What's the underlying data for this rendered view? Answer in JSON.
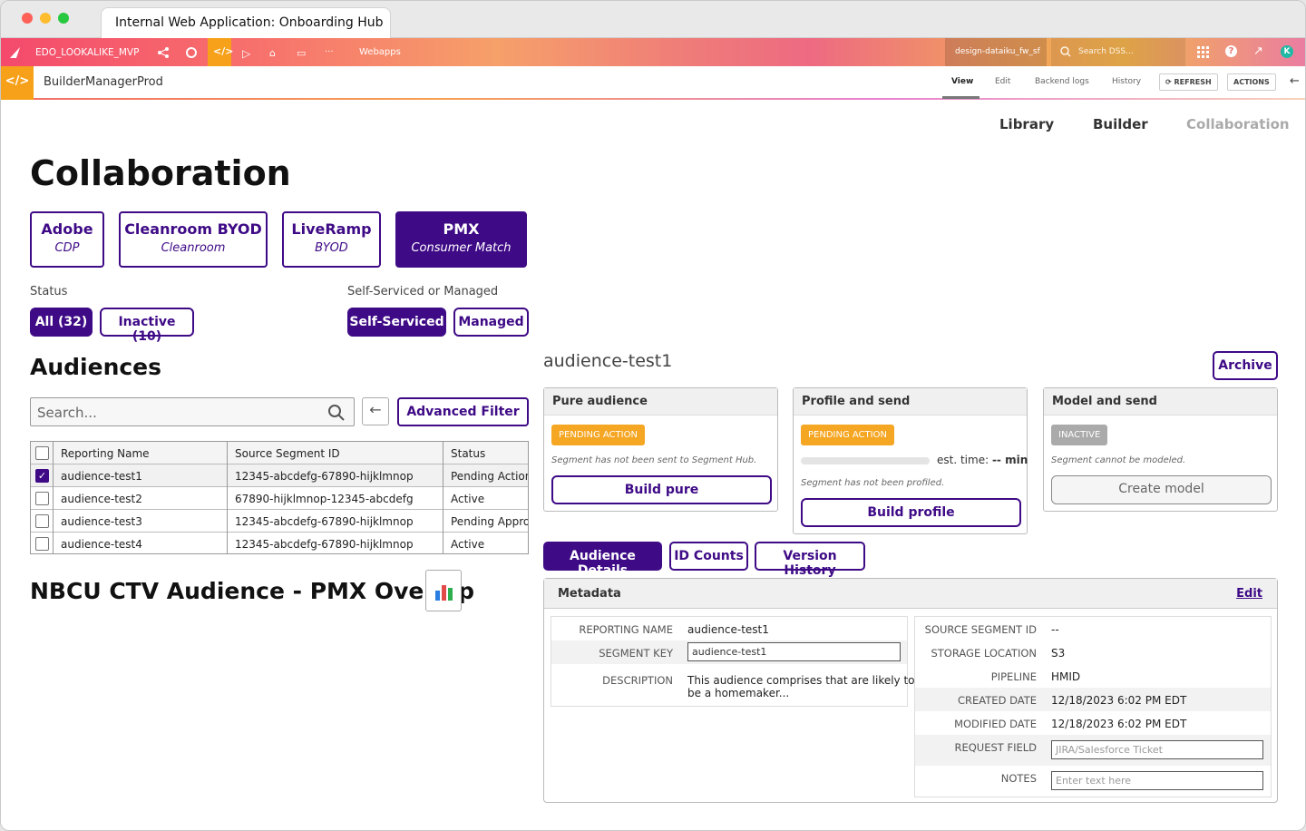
{
  "browser": {
    "tab_title": "Internal Web Application: Onboarding Hub"
  },
  "dss": {
    "project": "EDO_LOOKALIKE_MVP",
    "menu": "Webapps",
    "instance": "design-dataiku_fw_sf",
    "search_placeholder": "Search DSS...",
    "avatar": "K"
  },
  "webapp_bar": {
    "name": "BuilderManagerProd",
    "tabs": [
      "View",
      "Edit",
      "Backend logs",
      "History"
    ],
    "refresh": "REFRESH",
    "actions": "ACTIONS"
  },
  "topnav": [
    "Library",
    "Builder",
    "Collaboration"
  ],
  "page_title": "Collaboration",
  "partners": [
    {
      "name": "Adobe",
      "type": "CDP"
    },
    {
      "name": "Cleanroom BYOD",
      "type": "Cleanroom"
    },
    {
      "name": "LiveRamp",
      "type": "BYOD"
    },
    {
      "name": "PMX",
      "type": "Consumer Match"
    }
  ],
  "filters": {
    "status_label": "Status",
    "status_options": [
      "All (32)",
      "Inactive (10)"
    ],
    "service_label": "Self-Serviced or Managed",
    "service_options": [
      "Self-Serviced",
      "Managed"
    ]
  },
  "audiences": {
    "heading": "Audiences",
    "search_placeholder": "Search...",
    "advanced_filter": "Advanced Filter",
    "columns": [
      "Reporting Name",
      "Source Segment ID",
      "Status"
    ],
    "rows": [
      {
        "name": "audience-test1",
        "segment": "12345-abcdefg-67890-hijklmnop",
        "status": "Pending Action",
        "checked": true
      },
      {
        "name": "audience-test2",
        "segment": "67890-hijklmnop-12345-abcdefg",
        "status": "Active",
        "checked": false
      },
      {
        "name": "audience-test3",
        "segment": "12345-abcdefg-67890-hijklmnop",
        "status": "Pending Approval",
        "checked": false
      },
      {
        "name": "audience-test4",
        "segment": "12345-abcdefg-67890-hijklmnop",
        "status": "Active",
        "checked": false
      }
    ]
  },
  "overlap_title": "NBCU CTV Audience - PMX Overlap",
  "detail": {
    "audience_name": "audience-test1",
    "archive": "Archive",
    "cards": [
      {
        "title": "Pure audience",
        "badge": "PENDING ACTION",
        "note": "Segment has not been sent to Segment Hub.",
        "button": "Build pure"
      },
      {
        "title": "Profile and send",
        "badge": "PENDING ACTION",
        "est": "est. time:",
        "est_value": "-- min",
        "note": "Segment has not been profiled.",
        "button": "Build profile"
      },
      {
        "title": "Model and send",
        "badge": "INACTIVE",
        "note": "Segment cannot be modeled.",
        "button": "Create model"
      }
    ],
    "tabs": [
      "Audience Details",
      "ID Counts",
      "Version History"
    ],
    "metadata": {
      "heading": "Metadata",
      "edit": "Edit",
      "left": [
        {
          "k": "REPORTING NAME",
          "v": "audience-test1"
        },
        {
          "k": "SEGMENT KEY",
          "input": "audience-test1"
        },
        {
          "k": "DESCRIPTION",
          "v": "This audience comprises that are likely to",
          "v2": "be a homemaker..."
        }
      ],
      "right": [
        {
          "k": "SOURCE SEGMENT ID",
          "v": "--"
        },
        {
          "k": "STORAGE LOCATION",
          "v": "S3"
        },
        {
          "k": "PIPELINE",
          "v": "HMID"
        },
        {
          "k": "CREATED DATE",
          "v": "12/18/2023 6:02 PM EDT"
        },
        {
          "k": "MODIFIED DATE",
          "v": "12/18/2023 6:02 PM EDT"
        },
        {
          "k": "REQUEST FIELD",
          "placeholder": "JIRA/Salesforce Ticket"
        },
        {
          "k": "NOTES",
          "placeholder": "Enter text here"
        }
      ]
    }
  },
  "colors": {
    "brand": "#3e0a86",
    "pending": "#f5a623",
    "inactive": "#aaaaaa"
  }
}
